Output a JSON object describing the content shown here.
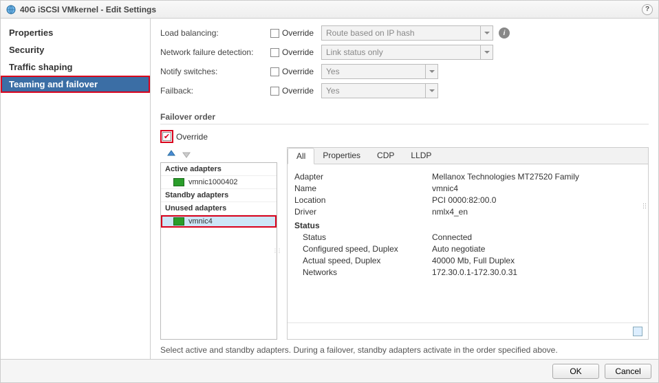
{
  "title": "40G iSCSI VMkernel - Edit Settings",
  "sidebar": {
    "items": [
      {
        "label": "Properties"
      },
      {
        "label": "Security"
      },
      {
        "label": "Traffic shaping"
      },
      {
        "label": "Teaming and failover"
      }
    ]
  },
  "form": {
    "load_balancing": {
      "label": "Load balancing:",
      "override": "Override",
      "value": "Route based on IP hash"
    },
    "failure_detect": {
      "label": "Network failure detection:",
      "override": "Override",
      "value": "Link status only"
    },
    "notify": {
      "label": "Notify switches:",
      "override": "Override",
      "value": "Yes"
    },
    "failback": {
      "label": "Failback:",
      "override": "Override",
      "value": "Yes"
    }
  },
  "failover": {
    "header": "Failover order",
    "override": "Override",
    "categories": {
      "active": "Active adapters",
      "standby": "Standby adapters",
      "unused": "Unused adapters"
    },
    "active_list": [
      {
        "name": "vmnic1000402"
      }
    ],
    "standby_list": [],
    "unused_list": [
      {
        "name": "vmnic4"
      }
    ]
  },
  "tabs": [
    "All",
    "Properties",
    "CDP",
    "LLDP"
  ],
  "details": {
    "adapter": {
      "k": "Adapter",
      "v": "Mellanox Technologies MT27520 Family"
    },
    "name": {
      "k": "Name",
      "v": "vmnic4"
    },
    "location": {
      "k": "Location",
      "v": "PCI 0000:82:00.0"
    },
    "driver": {
      "k": "Driver",
      "v": "nmlx4_en"
    },
    "status_hdr": "Status",
    "status": {
      "k": "Status",
      "v": "Connected"
    },
    "conf_speed": {
      "k": "Configured speed, Duplex",
      "v": "Auto negotiate"
    },
    "act_speed": {
      "k": "Actual speed, Duplex",
      "v": "40000 Mb, Full Duplex"
    },
    "networks": {
      "k": "Networks",
      "v": "172.30.0.1-172.30.0.31"
    }
  },
  "hint": "Select active and standby adapters. During a failover, standby adapters activate in the order specified above.",
  "buttons": {
    "ok": "OK",
    "cancel": "Cancel"
  }
}
